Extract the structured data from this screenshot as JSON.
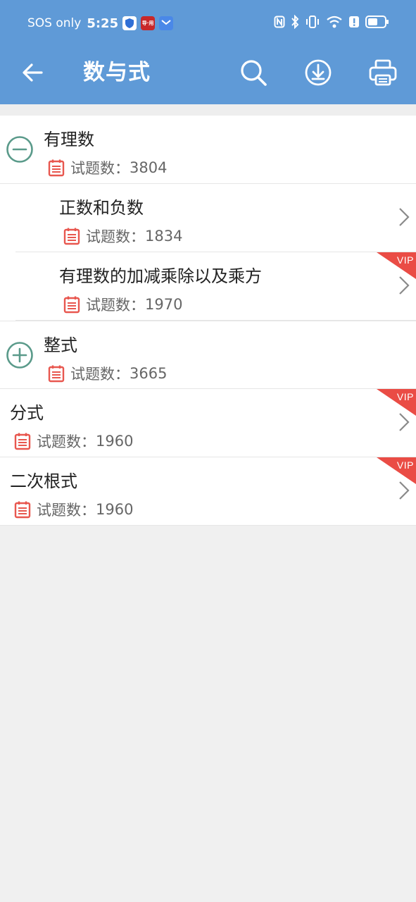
{
  "status": {
    "carrier": "SOS only",
    "time": "5:25",
    "badge_text": "导·用"
  },
  "header": {
    "title": "数与式",
    "bg_color": "#5f9ad7"
  },
  "list": {
    "count_prefix": "试题数：",
    "vip_label": "VIP",
    "items": [
      {
        "title": "有理数",
        "count": "3804",
        "level": 0,
        "state": "expanded",
        "vip": false,
        "chevron": false
      },
      {
        "title": "正数和负数",
        "count": "1834",
        "level": 1,
        "state": "leaf",
        "vip": false,
        "chevron": true
      },
      {
        "title": "有理数的加减乘除以及乘方",
        "count": "1970",
        "level": 1,
        "state": "leaf",
        "vip": true,
        "chevron": true
      },
      {
        "title": "整式",
        "count": "3665",
        "level": 0,
        "state": "collapsed",
        "vip": false,
        "chevron": false
      },
      {
        "title": "分式",
        "count": "1960",
        "level": 0,
        "state": "leaf",
        "vip": true,
        "chevron": true
      },
      {
        "title": "二次根式",
        "count": "1960",
        "level": 0,
        "state": "leaf",
        "vip": true,
        "chevron": true
      }
    ]
  },
  "colors": {
    "accent_red": "#e8574f",
    "toggle_green": "#5a9a8a",
    "vip_red": "#ea4c45"
  }
}
